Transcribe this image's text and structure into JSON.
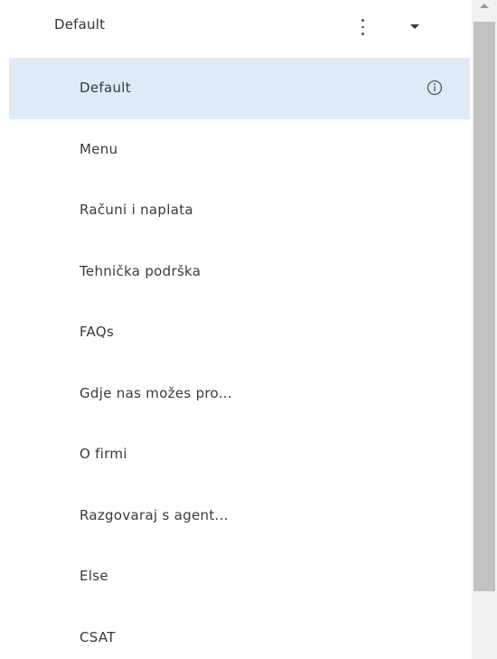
{
  "header": {
    "title": "Default"
  },
  "list": {
    "items": [
      {
        "label": "Default"
      },
      {
        "label": "Menu"
      },
      {
        "label": "Računi i naplata"
      },
      {
        "label": "Tehnička podrška"
      },
      {
        "label": "FAQs"
      },
      {
        "label": "Gdje nas možes pro..."
      },
      {
        "label": "O firmi"
      },
      {
        "label": "Razgovaraj s agent..."
      },
      {
        "label": "Else"
      },
      {
        "label": "CSAT"
      }
    ],
    "selected_index": 0
  },
  "icons": {
    "more": "kebab-menu-icon",
    "expand": "caret-down-icon",
    "info": "info-icon"
  },
  "colors": {
    "selected_background": "#deebf6",
    "text": "#3a3a3a",
    "scrollbar_track": "#f1f1f1",
    "scrollbar_thumb": "#c1c1c1"
  }
}
